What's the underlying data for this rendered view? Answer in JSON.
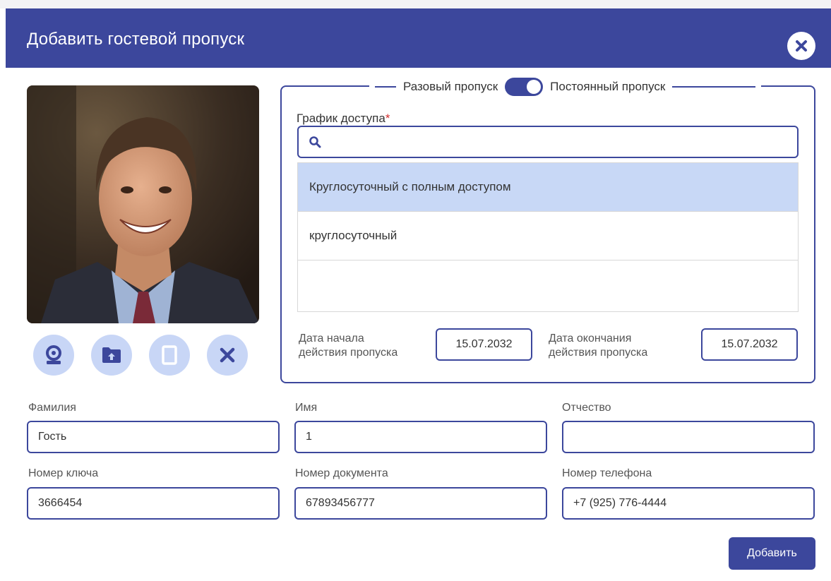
{
  "dialog": {
    "title": "Добавить гостевой пропуск",
    "close_icon": "close-icon",
    "accent_color": "#3c479c"
  },
  "photo": {
    "buttons": [
      {
        "icon": "webcam-icon",
        "enabled": true
      },
      {
        "icon": "folder-upload-icon",
        "enabled": true
      },
      {
        "icon": "document-icon",
        "enabled": false
      },
      {
        "icon": "close-icon",
        "enabled": true
      }
    ]
  },
  "pass_type": {
    "option_one_time": "Разовый пропуск",
    "option_permanent": "Постоянный пропуск",
    "selected": "Постоянный пропуск"
  },
  "schedule": {
    "label": "График доступа",
    "required_mark": "*",
    "search_placeholder": "",
    "search_value": "",
    "items": [
      {
        "label": "Круглосуточный с полным доступом",
        "selected": true
      },
      {
        "label": "круглосуточный",
        "selected": false
      }
    ]
  },
  "dates": {
    "start_label_line1": "Дата начала",
    "start_label_line2": "действия пропуска",
    "start_value": "15.07.2032",
    "end_label_line1": "Дата окончания",
    "end_label_line2": "действия пропуска",
    "end_value": "15.07.2032"
  },
  "fields": {
    "last_name": {
      "label": "Фамилия",
      "value": "Гость"
    },
    "first_name": {
      "label": "Имя",
      "value": "1"
    },
    "patronymic": {
      "label": "Отчество",
      "value": ""
    },
    "key_number": {
      "label": "Номер ключа",
      "value": "3666454"
    },
    "document_number": {
      "label": "Номер документа",
      "value": "67893456777"
    },
    "phone_number": {
      "label": "Номер телефона",
      "value": "+7 (925) 776-4444"
    }
  },
  "submit": {
    "label": "Добавить"
  }
}
